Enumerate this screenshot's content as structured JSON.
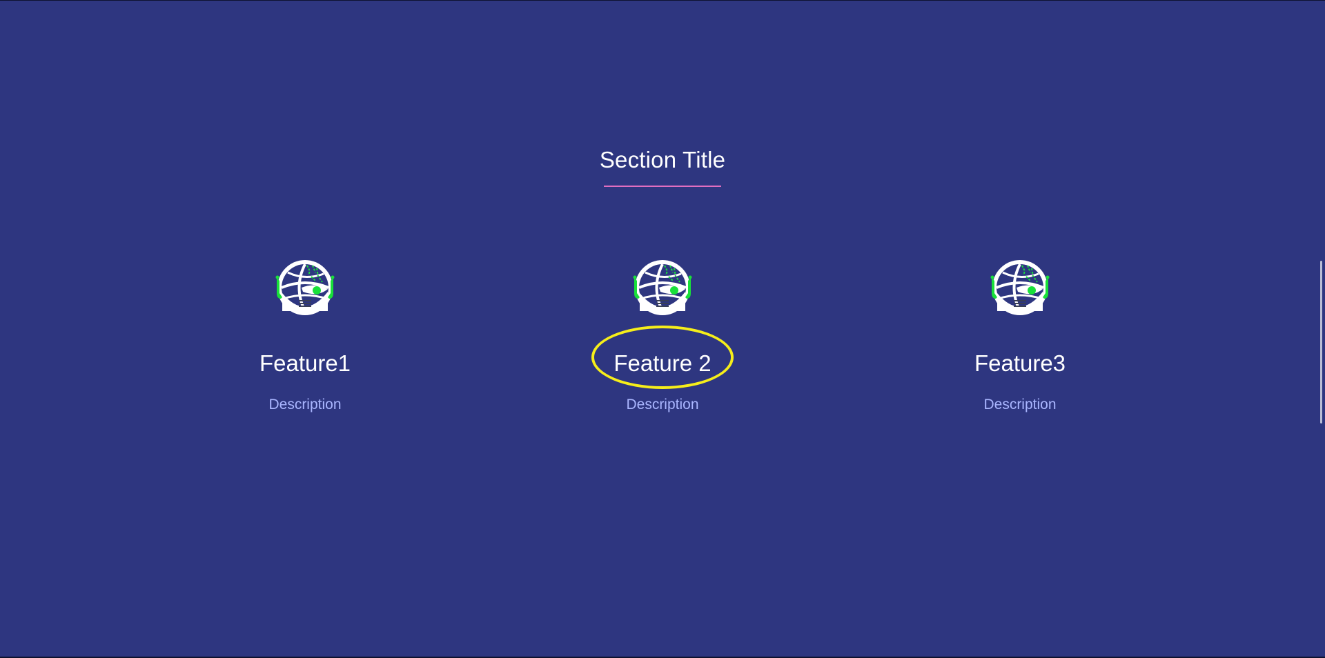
{
  "section": {
    "title": "Section Title",
    "underline_color": "#e06fc0"
  },
  "features": [
    {
      "title": "Feature1",
      "description": "Description",
      "icon": "globe-circuit-icon"
    },
    {
      "title": "Feature 2",
      "description": "Description",
      "icon": "globe-circuit-icon"
    },
    {
      "title": "Feature3",
      "description": "Description",
      "icon": "globe-circuit-icon"
    }
  ],
  "highlight": {
    "target": "Feature 2",
    "color": "#f6ee1a"
  },
  "colors": {
    "background": "#2e3680",
    "title_text": "#ffffff",
    "description_text": "#aab6ff",
    "icon_accent": "#19e03a"
  }
}
